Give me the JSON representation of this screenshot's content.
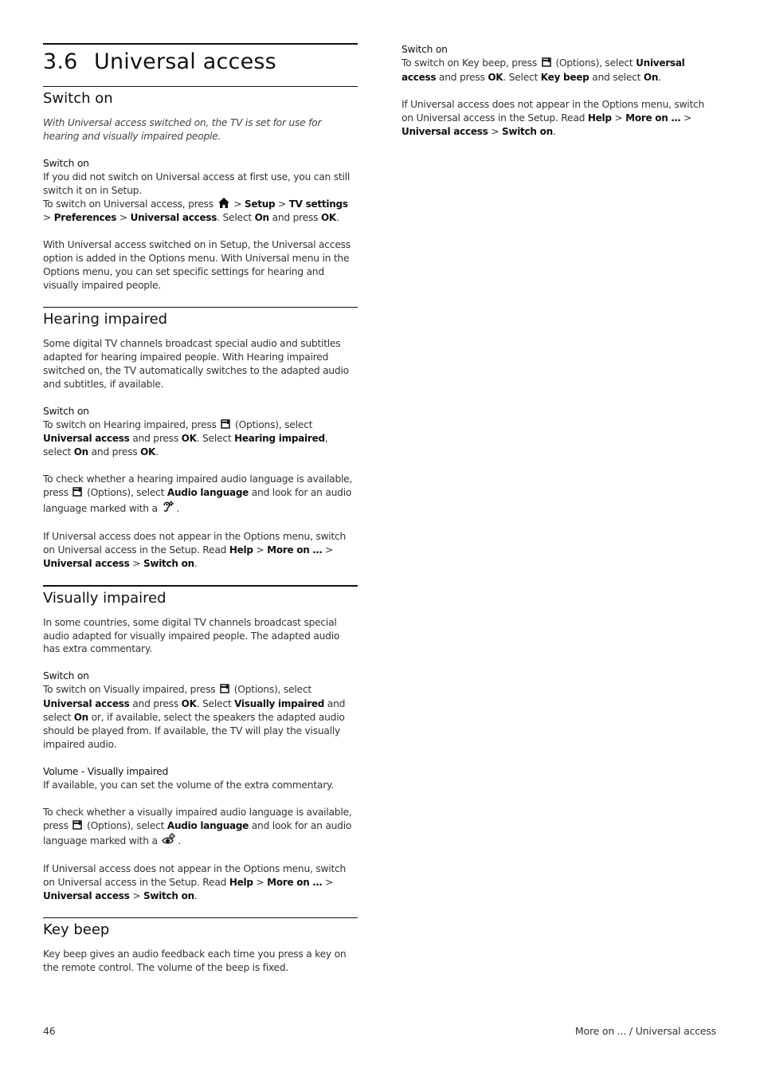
{
  "chapter": {
    "number": "3.6",
    "title": "Universal access"
  },
  "sections": {
    "switch_on": {
      "title": "Switch on",
      "intro": "With Universal access switched on, the TV is set for use for hearing and visually impaired people.",
      "sub_title": "Switch on",
      "p1": "If you did not switch on Universal access at first use, you can still switch it on in Setup.",
      "p2_a": "To switch on Universal access, press",
      "p2_b": ">",
      "p2_setup": "Setup",
      "p2_c": ">",
      "p2_tvsettings": "TV settings",
      "p2_d": ">",
      "p2_preferences": "Preferences",
      "p2_e": ">",
      "p2_ua": "Universal access",
      "p2_f": ". Select",
      "p2_on": "On",
      "p2_g": "and press",
      "p2_ok": "OK",
      "p2_h": ".",
      "p3": "With Universal access switched on in Setup, the Universal access option is added in the Options menu. With Universal menu in the Options menu, you can set specific settings for hearing and visually impaired people."
    },
    "hearing": {
      "title": "Hearing impaired",
      "p1": "Some digital TV channels broadcast special audio and subtitles adapted for hearing impaired people. With Hearing impaired switched on, the TV automatically switches to the adapted audio and subtitles, if available.",
      "sub_title": "Switch on",
      "p2_a": "To switch on Hearing impaired, press",
      "p2_b": "(Options), select",
      "p2_ua": "Universal access",
      "p2_c": "and press",
      "p2_ok1": "OK",
      "p2_d": ". Select",
      "p2_hi": "Hearing impaired",
      "p2_e": ", select",
      "p2_on": "On",
      "p2_f": "and press",
      "p2_ok2": "OK",
      "p2_g": ".",
      "p3_a": "To check whether a hearing impaired audio language is available, press",
      "p3_b": "(Options), select",
      "p3_al": "Audio language",
      "p3_c": "and look for an audio language marked with a",
      "p3_d": ".",
      "p4_a": "If Universal access does not appear in the Options menu, switch on Universal access in the Setup. Read",
      "p4_help": "Help",
      "p4_b": ">",
      "p4_more": "More on …",
      "p4_c": ">",
      "p4_ua": "Universal access",
      "p4_d": ">",
      "p4_so": "Switch on",
      "p4_e": "."
    },
    "visual": {
      "title": "Visually impaired",
      "p1": "In some countries, some digital TV channels broadcast special audio adapted for visually impaired people. The adapted audio has extra commentary.",
      "sub_title": "Switch on",
      "p2_a": "To switch on Visually impaired, press",
      "p2_b": "(Options), select",
      "p2_ua": "Universal access",
      "p2_c": "and press",
      "p2_ok": "OK",
      "p2_d": ". Select",
      "p2_vi": "Visually impaired",
      "p2_e": "and select",
      "p2_on": "On",
      "p2_f": "or, if available, select the speakers the adapted audio should be played from. If available, the TV will play the visually impaired audio.",
      "sub_title2": "Volume - Visually impaired",
      "p3": "If available, you can set the volume of the extra commentary.",
      "p4_a": "To check whether a visually impaired audio language is available, press",
      "p4_b": "(Options), select",
      "p4_al": "Audio language",
      "p4_c": "and look for an audio language marked with a",
      "p4_d": ".",
      "p5_a": "If Universal access does not appear in the Options menu, switch on Universal access in the Setup. Read",
      "p5_help": "Help",
      "p5_b": ">",
      "p5_more": "More on …",
      "p5_c": ">",
      "p5_ua": "Universal access",
      "p5_d": ">",
      "p5_so": "Switch on",
      "p5_e": "."
    },
    "keybeep": {
      "title": "Key beep",
      "p1": "Key beep gives an audio feedback each time you press a key on the remote control. The volume of the beep is fixed.",
      "sub_title": "Switch on",
      "p2_a": "To switch on Key beep, press",
      "p2_b": "(Options), select",
      "p2_ua": "Universal access",
      "p2_c": "and press",
      "p2_ok": "OK",
      "p2_d": ". Select",
      "p2_kb": "Key beep",
      "p2_e": "and select",
      "p2_on": "On",
      "p2_f": ".",
      "p3_a": "If Universal access does not appear in the Options menu, switch on Universal access in the Setup. Read",
      "p3_help": "Help",
      "p3_b": ">",
      "p3_more": "More on …",
      "p3_c": ">",
      "p3_ua": "Universal access",
      "p3_d": ">",
      "p3_so": "Switch on",
      "p3_e": "."
    }
  },
  "icons": {
    "home": "home-icon",
    "options": "options-icon",
    "hearing": "hearing-impaired-icon",
    "visual": "visually-impaired-icon"
  },
  "footer": {
    "page_number": "46",
    "breadcrumb": "More on ... / Universal access"
  }
}
